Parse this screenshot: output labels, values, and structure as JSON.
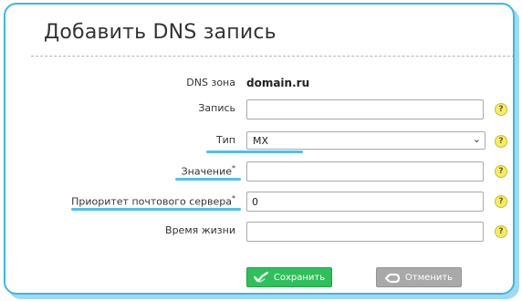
{
  "page": {
    "title": "Добавить DNS запись"
  },
  "form": {
    "zone": {
      "label": "DNS зона",
      "value": "domain.ru"
    },
    "record": {
      "label": "Запись",
      "value": ""
    },
    "type": {
      "label": "Тип",
      "selected": "MX"
    },
    "value": {
      "label": "Значение",
      "required_mark": "*",
      "value": ""
    },
    "priority": {
      "label": "Приоритет почтового сервера",
      "required_mark": "*",
      "value": "0"
    },
    "ttl": {
      "label": "Время жизни",
      "value": ""
    },
    "help_glyph": "?"
  },
  "actions": {
    "save_label": "Сохранить",
    "cancel_label": "Отменить"
  },
  "colors": {
    "accent": "#3cb6e6",
    "save": "#2fbf5b",
    "cancel": "#a9a9a9",
    "help": "#f3ec6b"
  }
}
